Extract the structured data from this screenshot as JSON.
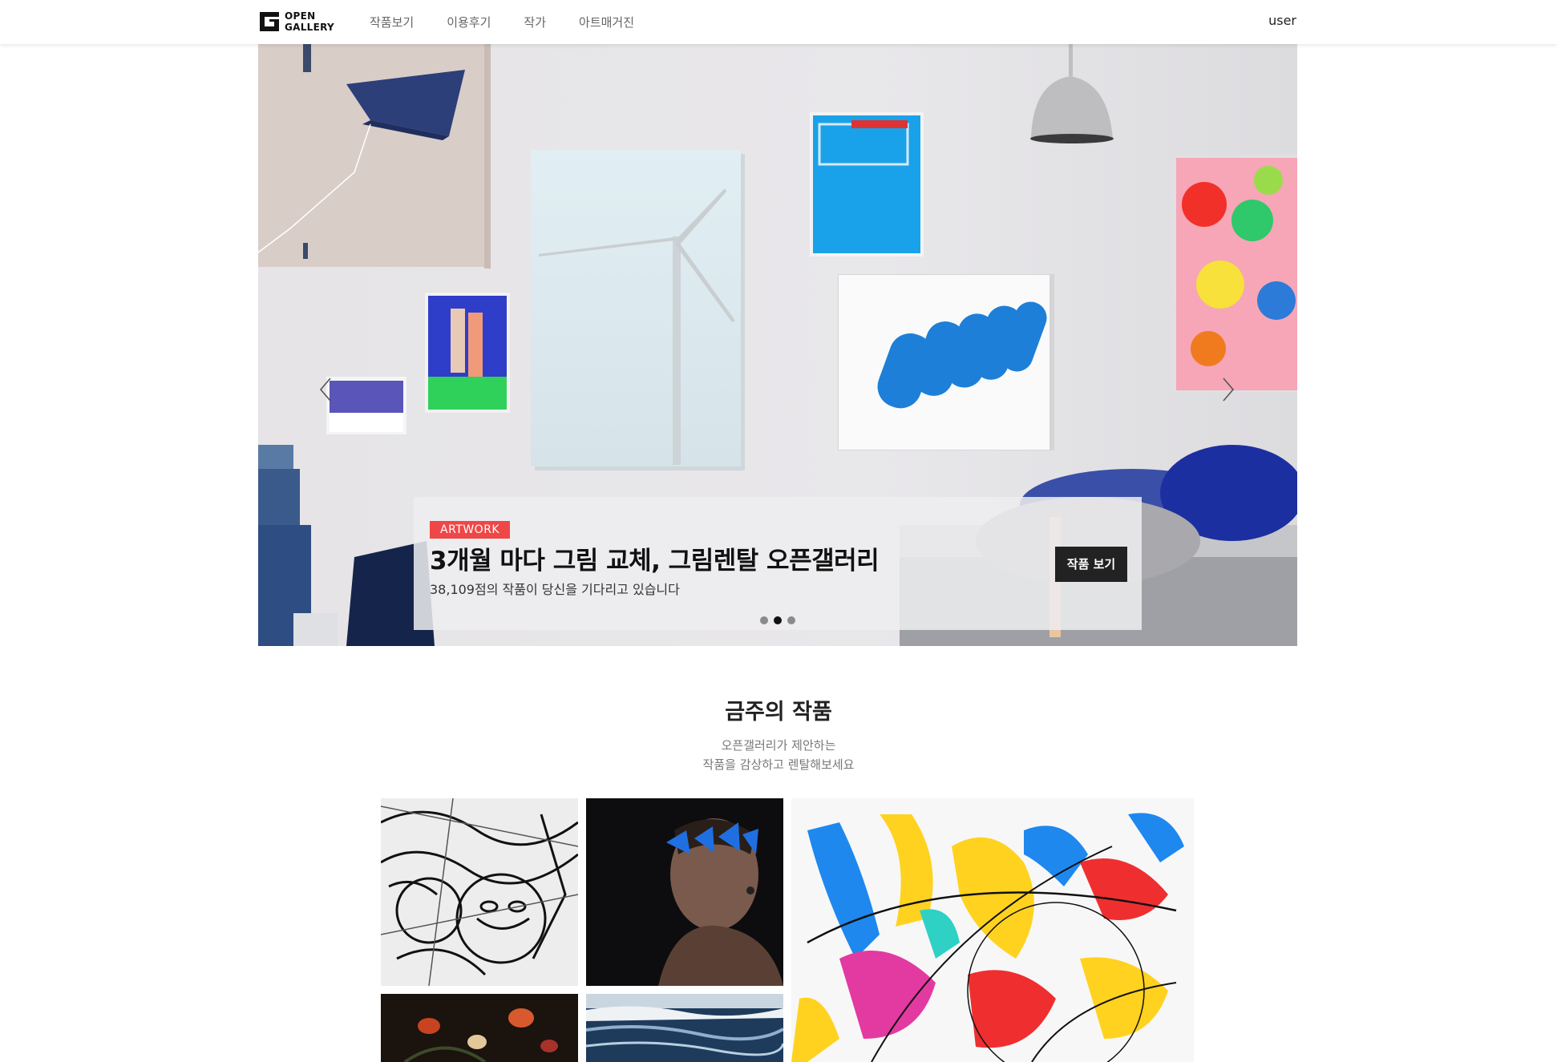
{
  "header": {
    "logo_line1": "OPEN",
    "logo_line2": "GALLERY",
    "nav": [
      "작품보기",
      "이용후기",
      "작가",
      "아트매거진"
    ],
    "user": "user"
  },
  "hero": {
    "badge": "ARTWORK",
    "title": "3개월 마다 그림 교체, 그림렌탈 오픈갤러리",
    "subtitle": "38,109점의 작품이 당신을 기다리고 있습니다",
    "cta": "작품 보기",
    "slide_count": 3,
    "active_slide": 2
  },
  "section": {
    "title": "금주의 작품",
    "subtitle_line1": "오픈갤러리가 제안하는",
    "subtitle_line2": "작품을 감상하고 렌탈해보세요"
  },
  "colors": {
    "badge": "#ef4747",
    "cta_bg": "#222222",
    "dot_active": "#111111",
    "dot_inactive": "#8a8a8a"
  }
}
